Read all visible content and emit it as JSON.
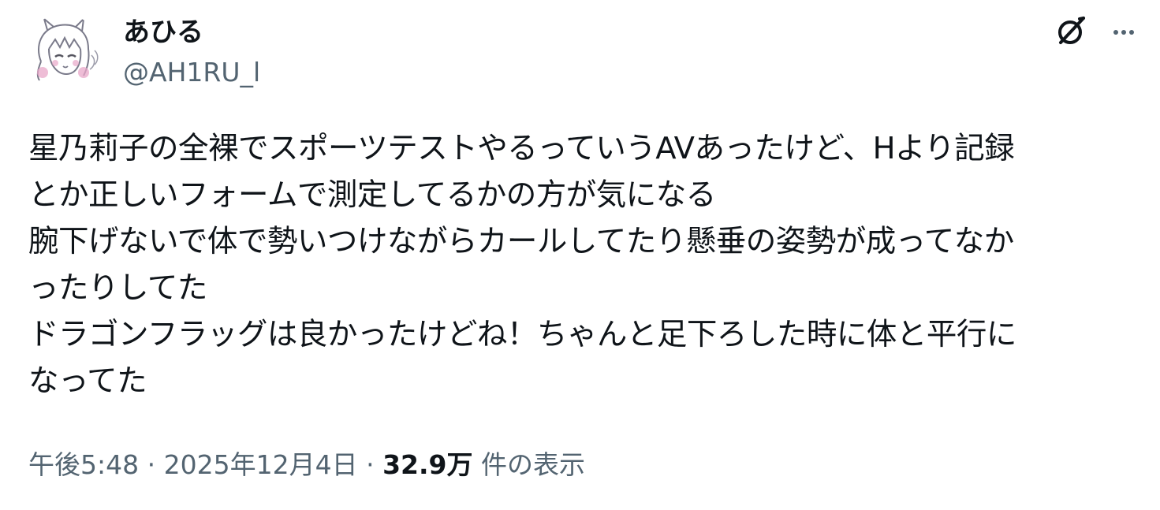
{
  "author": {
    "display_name": "あひる",
    "handle": "@AH1RU_l"
  },
  "tweet": {
    "lines": [
      "星乃莉子の全裸でスポーツテストやるっていうAVあったけど、Hより記録",
      "とか正しいフォームで測定してるかの方が気になる",
      "腕下げないで体で勢いつけながらカールしてたり懸垂の姿勢が成ってなか",
      "ったりしてた",
      "ドラゴンフラッグは良かったけどね！ちゃんと足下ろした時に体と平行に",
      "なってた"
    ]
  },
  "meta": {
    "time": "午後5:48",
    "separator": "·",
    "date": "2025年12月4日",
    "views_count": "32.9万",
    "views_label": "件の表示"
  },
  "icons": {
    "grok": "grok-icon",
    "more": "more-icon"
  },
  "colors": {
    "text_primary": "#0f1419",
    "text_secondary": "#536471"
  }
}
